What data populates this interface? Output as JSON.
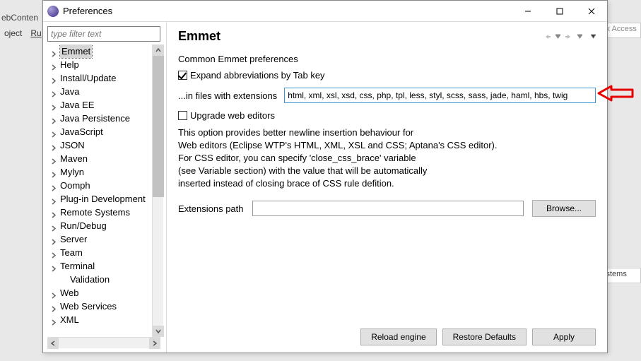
{
  "bg": {
    "menu_fragments": [
      "ebConten",
      "oject",
      "Ru"
    ],
    "quick_access": "ck Access",
    "bottom_tab": "ystems"
  },
  "dialog": {
    "title": "Preferences"
  },
  "sidebar": {
    "filter_placeholder": "type filter text",
    "items": [
      {
        "label": "Emmet",
        "expandable": true,
        "selected": true
      },
      {
        "label": "Help",
        "expandable": true
      },
      {
        "label": "Install/Update",
        "expandable": true
      },
      {
        "label": "Java",
        "expandable": true
      },
      {
        "label": "Java EE",
        "expandable": true
      },
      {
        "label": "Java Persistence",
        "expandable": true
      },
      {
        "label": "JavaScript",
        "expandable": true
      },
      {
        "label": "JSON",
        "expandable": true
      },
      {
        "label": "Maven",
        "expandable": true
      },
      {
        "label": "Mylyn",
        "expandable": true
      },
      {
        "label": "Oomph",
        "expandable": true
      },
      {
        "label": "Plug-in Development",
        "expandable": true
      },
      {
        "label": "Remote Systems",
        "expandable": true
      },
      {
        "label": "Run/Debug",
        "expandable": true
      },
      {
        "label": "Server",
        "expandable": true
      },
      {
        "label": "Team",
        "expandable": true
      },
      {
        "label": "Terminal",
        "expandable": true
      },
      {
        "label": "Validation",
        "expandable": false,
        "child": true
      },
      {
        "label": "Web",
        "expandable": true
      },
      {
        "label": "Web Services",
        "expandable": true
      },
      {
        "label": "XML",
        "expandable": true
      }
    ]
  },
  "main": {
    "title": "Emmet",
    "common_label": "Common Emmet preferences",
    "expand_tab_label": "Expand abbreviations by Tab key",
    "extensions_label": "...in files with extensions",
    "extensions_value": "html, xml, xsl, xsd, css, php, tpl, less, styl, scss, sass, jade, haml, hbs, twig",
    "upgrade_label": "Upgrade web editors",
    "desc_line1": "This option provides better newline insertion behaviour for",
    "desc_line2": "Web editors (Eclipse WTP's HTML, XML, XSL and CSS; Aptana's CSS editor).",
    "desc_line3": "For CSS editor, you can specify 'close_css_brace' variable",
    "desc_line4": "(see Variable section) with the value that will be automatically",
    "desc_line5": "inserted instead of closing brace of CSS rule defition.",
    "ext_path_label": "Extensions path",
    "browse_label": "Browse...",
    "reload_label": "Reload engine",
    "restore_label": "Restore Defaults",
    "apply_label": "Apply"
  }
}
